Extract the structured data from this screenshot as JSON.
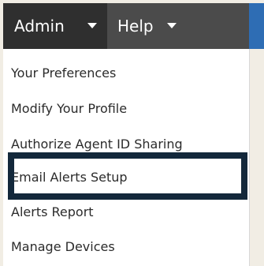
{
  "menubar": {
    "admin_label": "Admin",
    "help_label": "Help",
    "caret_icon": "caret-down-icon",
    "accent_color": "#2e6db4"
  },
  "dropdown": {
    "items": [
      {
        "label": "Your Preferences"
      },
      {
        "label": "Modify Your Profile"
      },
      {
        "label": "Authorize Agent ID Sharing"
      },
      {
        "label": "Email Alerts Setup"
      },
      {
        "label": "Alerts Report"
      },
      {
        "label": "Manage Devices"
      }
    ],
    "highlight_color": "#13283b"
  }
}
